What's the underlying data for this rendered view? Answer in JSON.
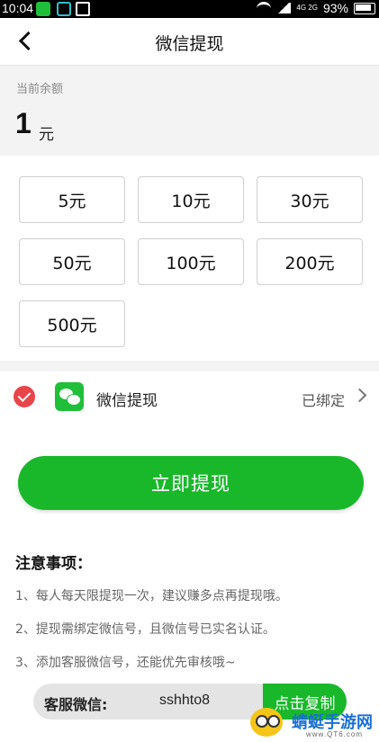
{
  "status_bar": {
    "time": "10:04",
    "network": "4G 2G",
    "battery": "93%"
  },
  "header": {
    "title": "微信提现"
  },
  "balance": {
    "label": "当前余额",
    "amount": "1",
    "unit": "元"
  },
  "amounts": [
    "5元",
    "10元",
    "30元",
    "50元",
    "100元",
    "200元",
    "500元"
  ],
  "selected_amount": null,
  "payment": {
    "method": "微信提现",
    "status": "已绑定",
    "selected": true
  },
  "withdraw_label": "立即提现",
  "notes": {
    "title": "注意事项：",
    "items": [
      "1、每人每天限提现一次，建议赚多点再提现哦。",
      "2、提现需绑定微信号，且微信号已实名认证。",
      "3、添加客服微信号，还能优先审核哦~"
    ]
  },
  "contact": {
    "label": "客服微信:",
    "value": "sshhto8",
    "copy_label": "点击复制"
  },
  "watermark": {
    "name": "蜻蜓手游网",
    "domain": "www.QT6.com"
  },
  "colors": {
    "accent": "#19b82b",
    "check": "#e8454a",
    "background_band": "#f3f3f3"
  }
}
